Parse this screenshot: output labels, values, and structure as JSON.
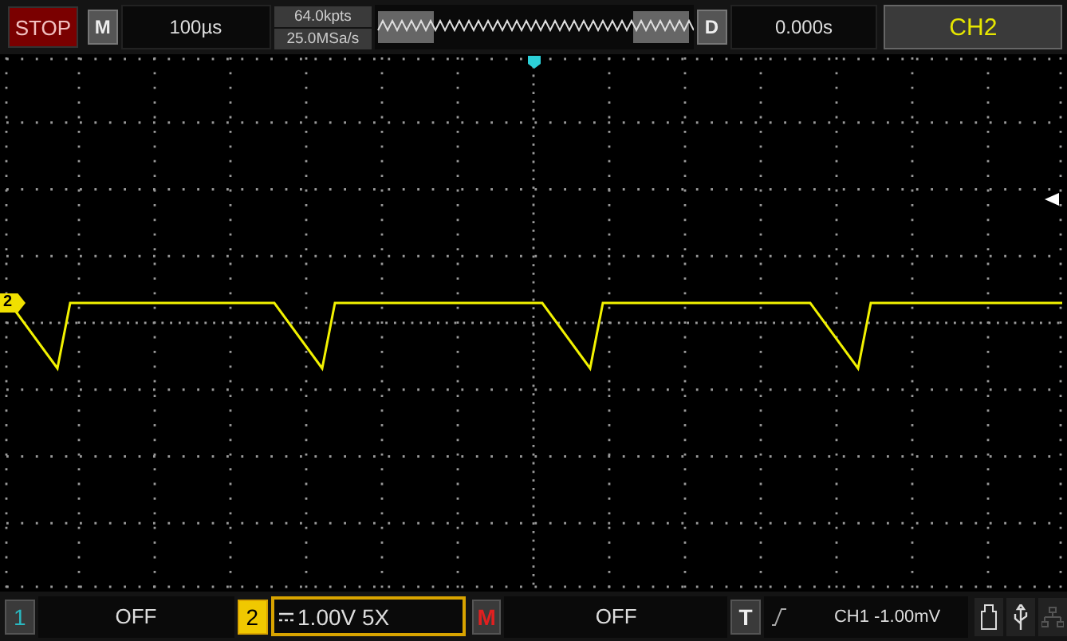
{
  "top_bar": {
    "run_state": "STOP",
    "menu_key": "M",
    "timebase": "100µs",
    "memory_depth": "64.0kpts",
    "sample_rate": "25.0MSa/s",
    "delay_key": "D",
    "trigger_delay": "0.000s",
    "active_channel": "CH2"
  },
  "screen": {
    "channel_marker": "2"
  },
  "bottom_bar": {
    "ch1_key": "1",
    "ch1_status": "OFF",
    "ch2_key": "2",
    "ch2_scale": "1.00V 5X",
    "math_key": "M",
    "math_status": "OFF",
    "trigger_key": "T",
    "trigger_info": "CH1 -1.00mV"
  }
}
